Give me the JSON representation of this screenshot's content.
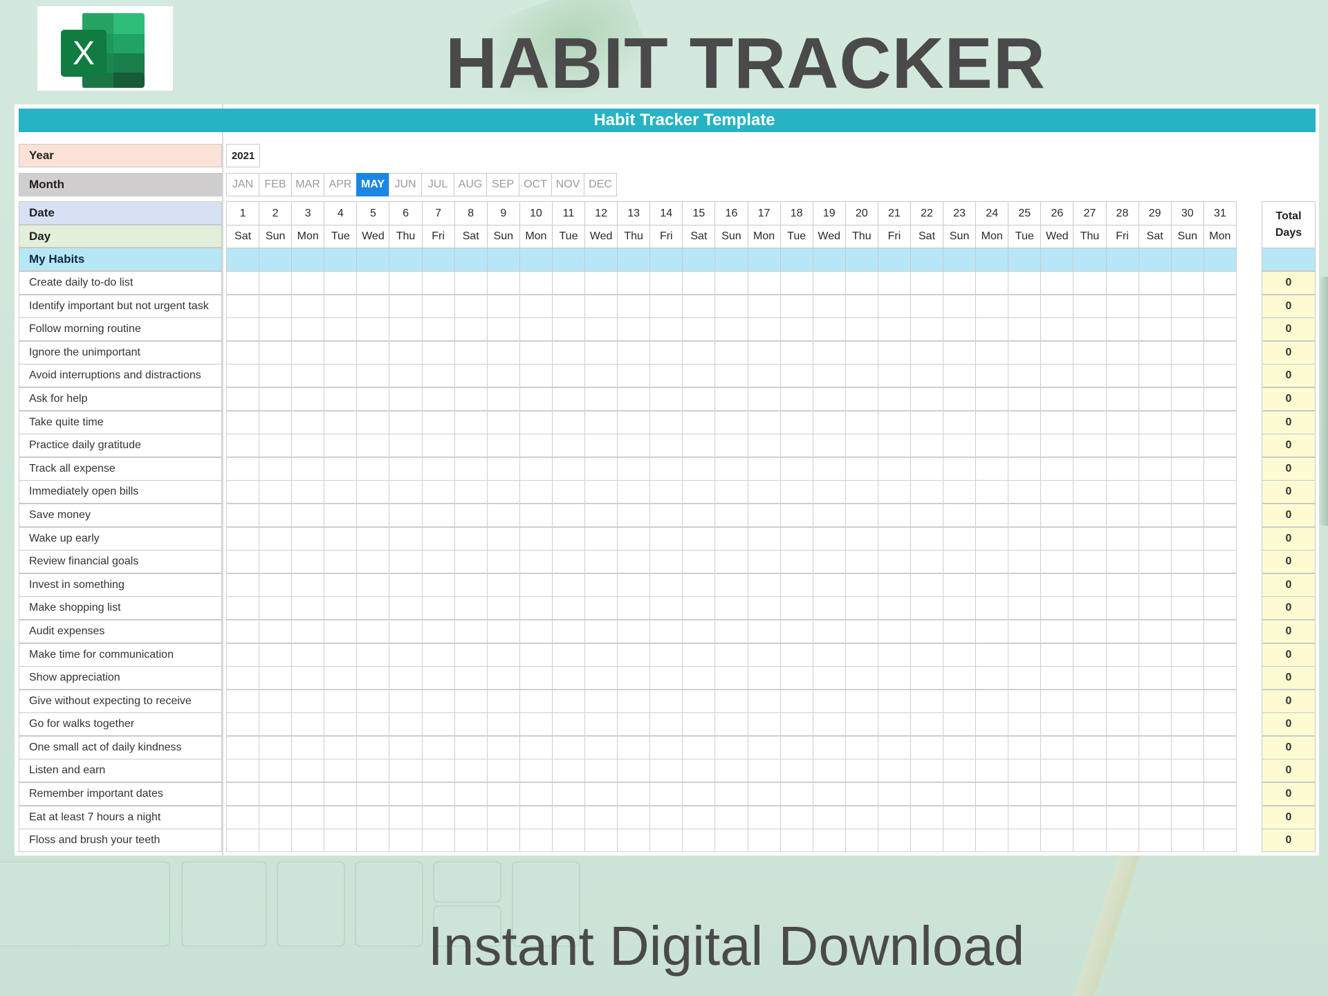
{
  "header": {
    "title": "HABIT TRACKER",
    "logo_icon": "excel-icon",
    "logo_letter": "X"
  },
  "sheet": {
    "title": "Habit Tracker Template",
    "labels": {
      "year": "Year",
      "month": "Month",
      "date": "Date",
      "day": "Day",
      "habits": "My Habits",
      "total_line1": "Total",
      "total_line2": "Days"
    },
    "year_value": "2021",
    "months": [
      "JAN",
      "FEB",
      "MAR",
      "APR",
      "MAY",
      "JUN",
      "JUL",
      "AUG",
      "SEP",
      "OCT",
      "NOV",
      "DEC"
    ],
    "selected_month": "MAY",
    "dates": [
      "1",
      "2",
      "3",
      "4",
      "5",
      "6",
      "7",
      "8",
      "9",
      "10",
      "11",
      "12",
      "13",
      "14",
      "15",
      "16",
      "17",
      "18",
      "19",
      "20",
      "21",
      "22",
      "23",
      "24",
      "25",
      "26",
      "27",
      "28",
      "29",
      "30",
      "31"
    ],
    "days": [
      "Sat",
      "Sun",
      "Mon",
      "Tue",
      "Wed",
      "Thu",
      "Fri",
      "Sat",
      "Sun",
      "Mon",
      "Tue",
      "Wed",
      "Thu",
      "Fri",
      "Sat",
      "Sun",
      "Mon",
      "Tue",
      "Wed",
      "Thu",
      "Fri",
      "Sat",
      "Sun",
      "Mon",
      "Tue",
      "Wed",
      "Thu",
      "Fri",
      "Sat",
      "Sun",
      "Mon"
    ],
    "habits": [
      {
        "name": "Create daily to-do list",
        "total": "0"
      },
      {
        "name": "Identify important but not urgent task",
        "total": "0"
      },
      {
        "name": "Follow morning routine",
        "total": "0"
      },
      {
        "name": "Ignore the unimportant",
        "total": "0"
      },
      {
        "name": "Avoid interruptions and distractions",
        "total": "0"
      },
      {
        "name": "Ask for help",
        "total": "0"
      },
      {
        "name": "Take quite time",
        "total": "0"
      },
      {
        "name": "Practice daily gratitude",
        "total": "0"
      },
      {
        "name": "Track all expense",
        "total": "0"
      },
      {
        "name": "Immediately open bills",
        "total": "0"
      },
      {
        "name": "Save money",
        "total": "0"
      },
      {
        "name": "Wake up early",
        "total": "0"
      },
      {
        "name": "Review financial goals",
        "total": "0"
      },
      {
        "name": "Invest in something",
        "total": "0"
      },
      {
        "name": "Make shopping list",
        "total": "0"
      },
      {
        "name": "Audit expenses",
        "total": "0"
      },
      {
        "name": "Make time for communication",
        "total": "0"
      },
      {
        "name": "Show appreciation",
        "total": "0"
      },
      {
        "name": "Give without expecting to receive",
        "total": "0"
      },
      {
        "name": "Go for walks together",
        "total": "0"
      },
      {
        "name": "One small act of daily kindness",
        "total": "0"
      },
      {
        "name": "Listen and earn",
        "total": "0"
      },
      {
        "name": "Remember important dates",
        "total": "0"
      },
      {
        "name": "Eat at least 7 hours a night",
        "total": "0"
      },
      {
        "name": "Floss and brush your teeth",
        "total": "0"
      }
    ]
  },
  "footer": {
    "tagline": "Instant Digital Download"
  },
  "colors": {
    "teal_header": "#26b3c4",
    "selected_month": "#1b87e4",
    "year_label": "#fbe1d6",
    "month_label": "#d0cecf",
    "date_label": "#d8e1f4",
    "day_label": "#e2efd9",
    "habits_band": "#b7e7f7",
    "total_cell": "#fdfbd2",
    "background": "#d3e9dd"
  }
}
